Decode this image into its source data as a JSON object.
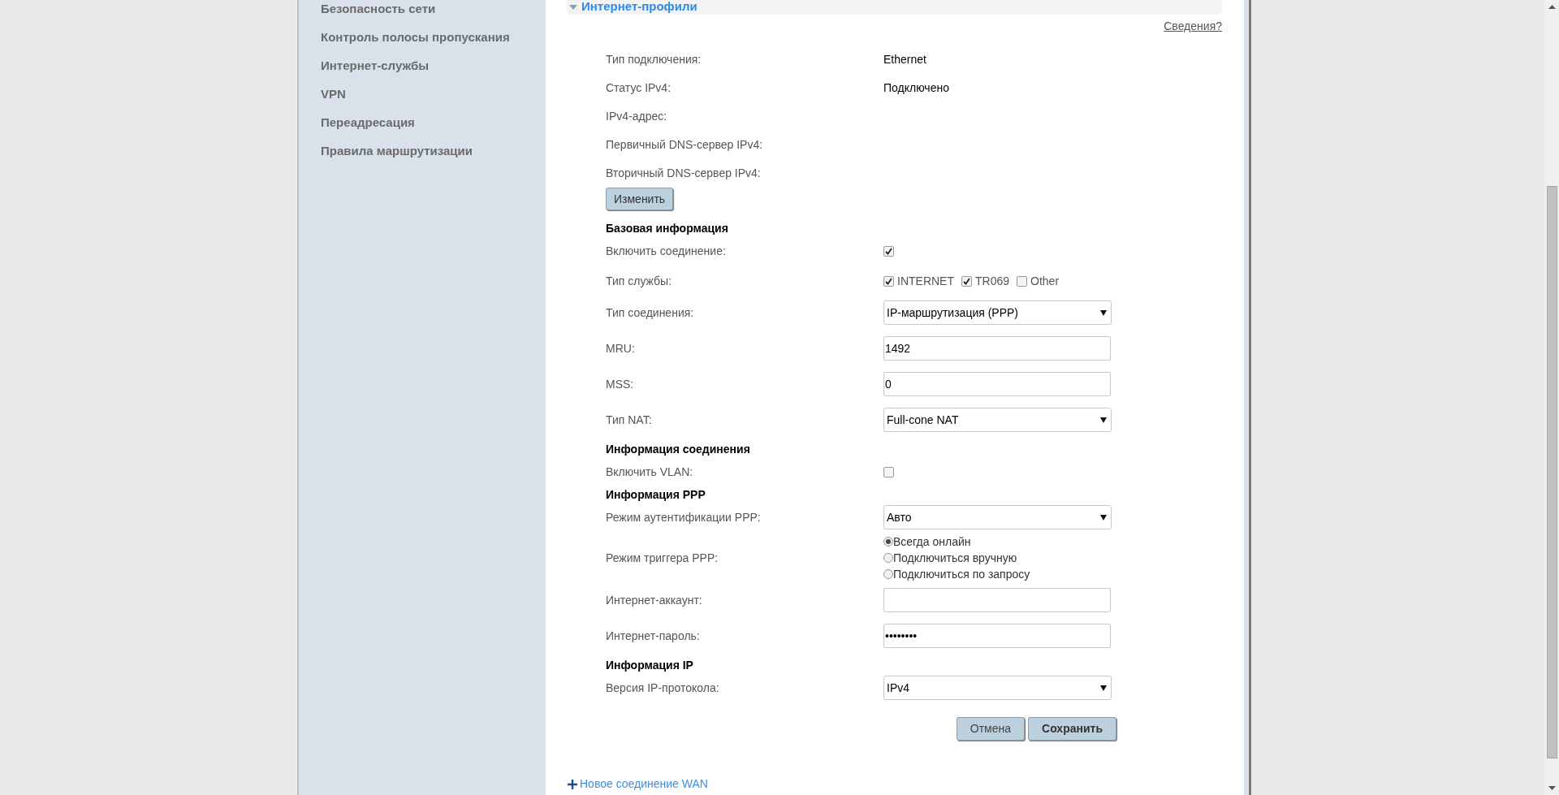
{
  "sidebar": {
    "items": [
      {
        "label": "Безопасность сети",
        "selected": false
      },
      {
        "label": "Контроль полосы пропускания",
        "selected": false
      },
      {
        "label": "Интернет-службы",
        "selected": false
      },
      {
        "label": "VPN",
        "selected": false
      },
      {
        "label": "Переадресация",
        "selected": false
      },
      {
        "label": "Правила маршрутизации",
        "selected": false
      }
    ]
  },
  "section": {
    "title": "Интернет-профили",
    "expanded": true,
    "help_link": "Сведения?"
  },
  "status": [
    {
      "label": "Тип подключения:",
      "value": "Ethernet"
    },
    {
      "label": "Статус IPv4:",
      "value": "Подключено"
    },
    {
      "label": "IPv4-адрес:"
    },
    {
      "label": "Первичный DNS-сервер IPv4:"
    },
    {
      "label": "Вторичный DNS-сервер IPv4:"
    }
  ],
  "edit_button": "Изменить",
  "fields": [
    {
      "kind": "heading",
      "label": "Базовая информация"
    },
    {
      "kind": "checkbox",
      "label": "Включить соединение:",
      "checked": true
    },
    {
      "kind": "checkgroup",
      "label": "Тип службы:",
      "options": [
        {
          "label": "INTERNET",
          "checked": true
        },
        {
          "label": "TR069",
          "checked": true
        },
        {
          "label": "Other",
          "checked": false
        }
      ]
    },
    {
      "kind": "select",
      "label": "Тип соединения:",
      "value": "IP-маршрутизация (PPP)"
    },
    {
      "kind": "text",
      "label": "MRU:",
      "value": "1492"
    },
    {
      "kind": "text",
      "label": "MSS:",
      "value": "0"
    },
    {
      "kind": "select",
      "label": "Тип NAT:",
      "value": "Full-cone NAT"
    },
    {
      "kind": "heading",
      "label": "Информация соединения"
    },
    {
      "kind": "checkbox",
      "label": "Включить VLAN:",
      "checked": false
    },
    {
      "kind": "heading",
      "label": "Информация PPP"
    },
    {
      "kind": "select",
      "label": "Режим аутентификации PPP:",
      "value": "Авто"
    },
    {
      "kind": "radiogroup",
      "label": "Режим триггера PPP:",
      "options": [
        {
          "label": "Всегда онлайн",
          "selected": true
        },
        {
          "label": "Подключиться вручную",
          "selected": false
        },
        {
          "label": "Подключиться по запросу",
          "selected": false
        }
      ]
    },
    {
      "kind": "text",
      "label": "Интернет-аккаунт:"
    },
    {
      "kind": "password",
      "label": "Интернет-пароль:",
      "value": "••••••••"
    },
    {
      "kind": "heading",
      "label": "Информация IP"
    },
    {
      "kind": "select",
      "label": "Версия IP-протокола:",
      "value": "IPv4"
    }
  ],
  "actions": [
    "Отмена",
    "Сохранить"
  ],
  "new_connection_link": "Новое соединение WAN"
}
